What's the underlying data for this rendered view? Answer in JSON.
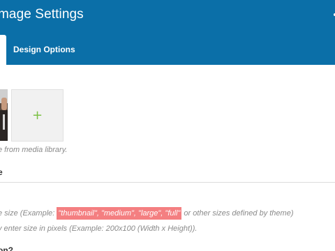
{
  "header": {
    "title": "mage Settings",
    "tabs": [
      {
        "label": ""
      },
      {
        "label": "Design Options"
      }
    ]
  },
  "image_field": {
    "add_symbol": "+",
    "help_text": "e from media library."
  },
  "size_field": {
    "label": "e",
    "value": "",
    "help_prefix": "e size (Example: ",
    "help_highlight": "\"thumbnail\", \"medium\", \"large\", \"full\"",
    "help_suffix": " or other sizes defined by theme)",
    "help_line2": "y enter size in pixels (Example: 200x100 (Width x Height))."
  },
  "next_field": {
    "label": "on?"
  },
  "colors": {
    "header_bg": "#0b6fa8",
    "add_icon": "#7bc144",
    "highlight": "#f47f81"
  }
}
